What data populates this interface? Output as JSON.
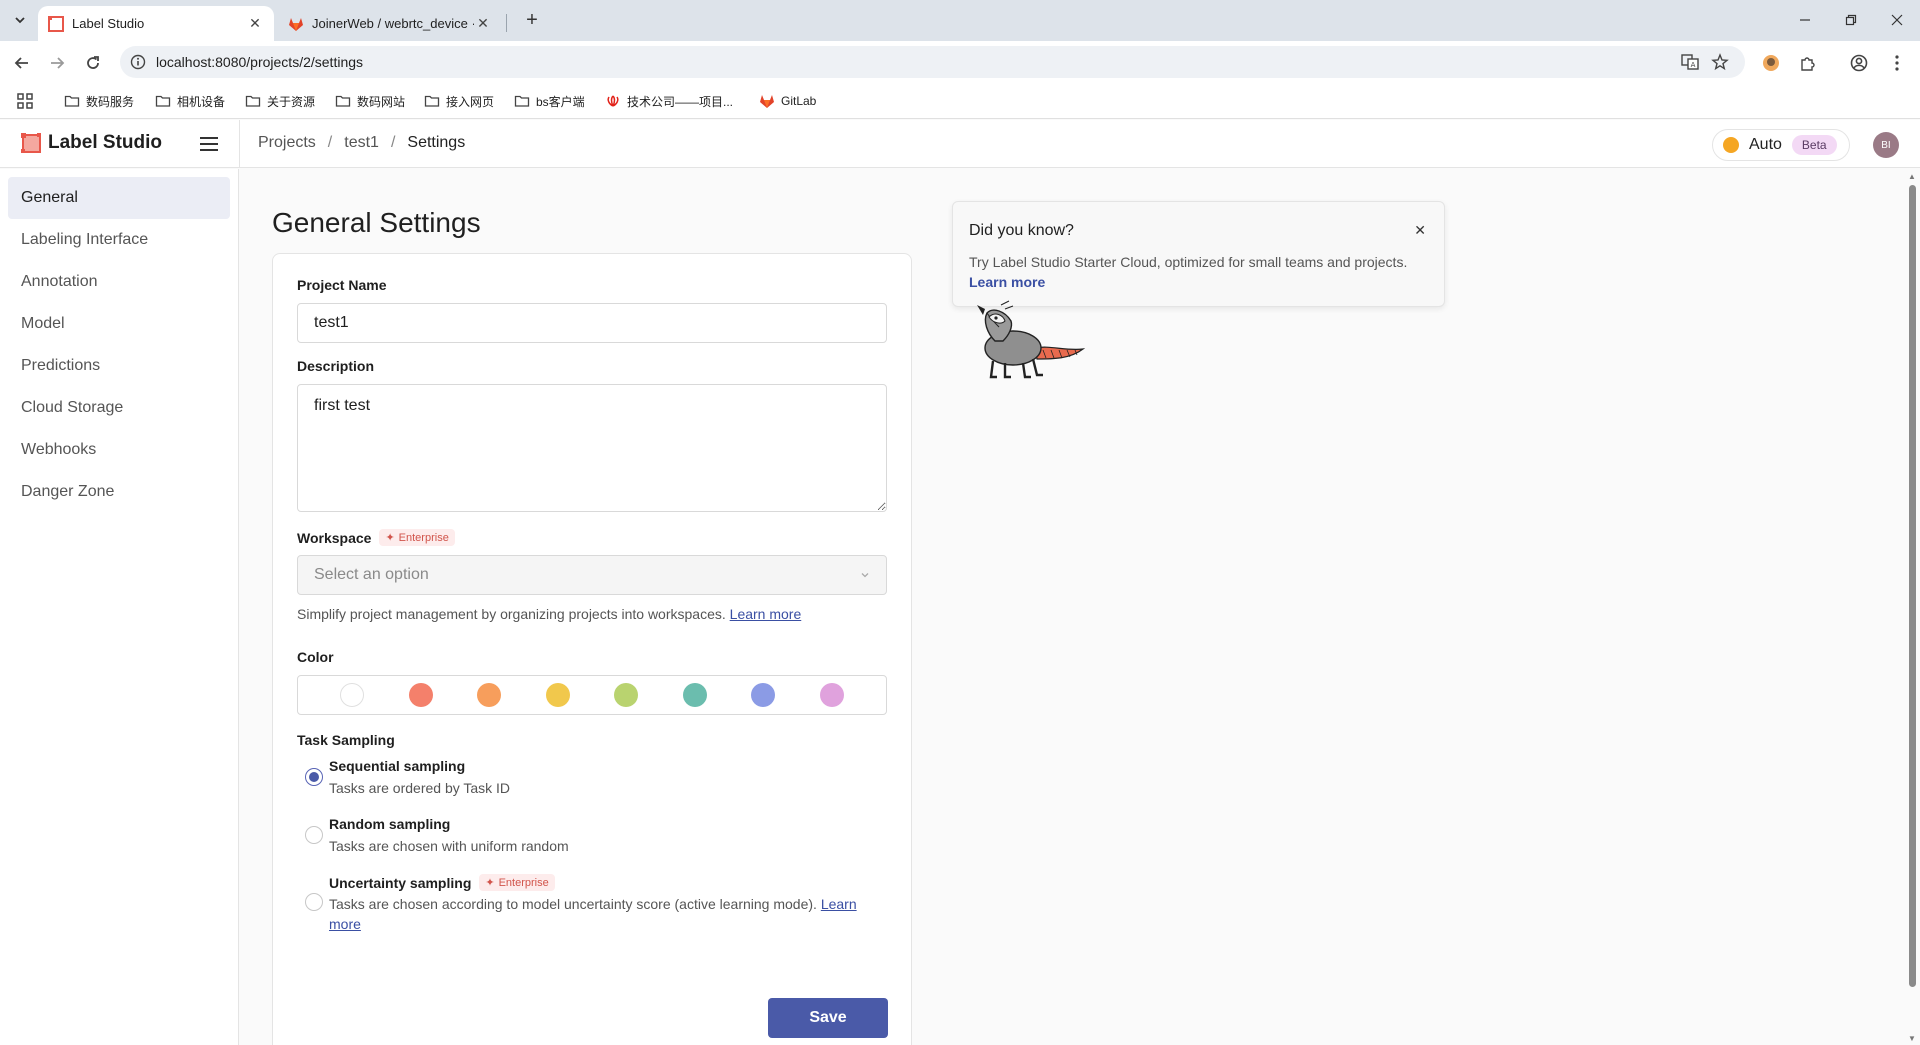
{
  "browser": {
    "tabs": [
      {
        "title": "Label Studio",
        "favicon": "label-studio-favicon",
        "active": true
      },
      {
        "title": "JoinerWeb / webrtc_device · ",
        "favicon": "gitlab-favicon",
        "active": false
      }
    ],
    "url": "localhost:8080/projects/2/settings",
    "bookmarks": [
      {
        "label": "数码服务",
        "icon": "folder-icon"
      },
      {
        "label": "相机设备",
        "icon": "folder-icon"
      },
      {
        "label": "关于资源",
        "icon": "folder-icon"
      },
      {
        "label": "数码网站",
        "icon": "folder-icon"
      },
      {
        "label": "接入网页",
        "icon": "folder-icon"
      },
      {
        "label": "bs客户端",
        "icon": "folder-icon"
      },
      {
        "label": "技术公司——项目...",
        "icon": "huawei-icon"
      },
      {
        "label": "GitLab",
        "icon": "gitlab-icon"
      }
    ]
  },
  "app": {
    "brand": "Label Studio",
    "breadcrumb": [
      "Projects",
      "test1",
      "Settings"
    ],
    "mode_label": "Auto",
    "mode_badge": "Beta",
    "avatar_initials": "BI"
  },
  "sidebar": {
    "items": [
      {
        "label": "General",
        "active": true
      },
      {
        "label": "Labeling Interface"
      },
      {
        "label": "Annotation"
      },
      {
        "label": "Model"
      },
      {
        "label": "Predictions"
      },
      {
        "label": "Cloud Storage"
      },
      {
        "label": "Webhooks"
      },
      {
        "label": "Danger Zone"
      }
    ]
  },
  "settings": {
    "title": "General Settings",
    "project_name_label": "Project Name",
    "project_name_value": "test1",
    "description_label": "Description",
    "description_value": "first test",
    "workspace_label": "Workspace",
    "enterprise_badge": "Enterprise",
    "workspace_placeholder": "Select an option",
    "workspace_help": "Simplify project management by organizing projects into workspaces.",
    "learn_more": "Learn more",
    "color_label": "Color",
    "colors": [
      "#ffffff",
      "#f4806b",
      "#f79e5c",
      "#f1c84c",
      "#b9d36f",
      "#6bbdae",
      "#8b9be5",
      "#e0a2dd"
    ],
    "task_sampling_label": "Task Sampling",
    "sampling_options": [
      {
        "title": "Sequential sampling",
        "desc": "Tasks are ordered by Task ID",
        "checked": true
      },
      {
        "title": "Random sampling",
        "desc": "Tasks are chosen with uniform random",
        "checked": false
      },
      {
        "title": "Uncertainty sampling",
        "desc": "Tasks are chosen according to model uncertainty score (active learning mode).",
        "link": "Learn more",
        "checked": false
      }
    ],
    "save_label": "Save"
  },
  "tip": {
    "title": "Did you know?",
    "body": "Try Label Studio Starter Cloud, optimized for small teams and projects.",
    "link": "Learn more"
  }
}
